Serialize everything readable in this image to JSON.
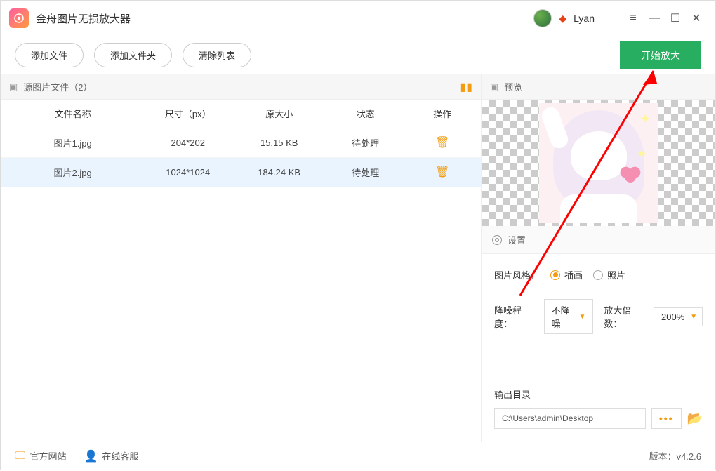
{
  "titlebar": {
    "app_title": "金舟图片无损放大器",
    "username": "Lyan"
  },
  "toolbar": {
    "add_file": "添加文件",
    "add_folder": "添加文件夹",
    "clear_list": "清除列表",
    "start": "开始放大"
  },
  "left": {
    "source_label": "源图片文件（2）",
    "columns": {
      "name": "文件名称",
      "size": "尺寸（px）",
      "orig": "原大小",
      "status": "状态",
      "action": "操作"
    },
    "rows": [
      {
        "name": "图片1.jpg",
        "size": "204*202",
        "orig": "15.15 KB",
        "status": "待处理"
      },
      {
        "name": "图片2.jpg",
        "size": "1024*1024",
        "orig": "184.24 KB",
        "status": "待处理"
      }
    ]
  },
  "right": {
    "preview_label": "预览",
    "settings_label": "设置",
    "style_label": "图片风格：",
    "style_options": {
      "illustration": "插画",
      "photo": "照片"
    },
    "noise_label": "降噪程度：",
    "noise_value": "不降噪",
    "scale_label": "放大倍数：",
    "scale_value": "200%",
    "output_label": "输出目录",
    "output_path": "C:\\Users\\admin\\Desktop"
  },
  "footer": {
    "site": "官方网站",
    "support": "在线客服",
    "version": "版本：v4.2.6"
  }
}
